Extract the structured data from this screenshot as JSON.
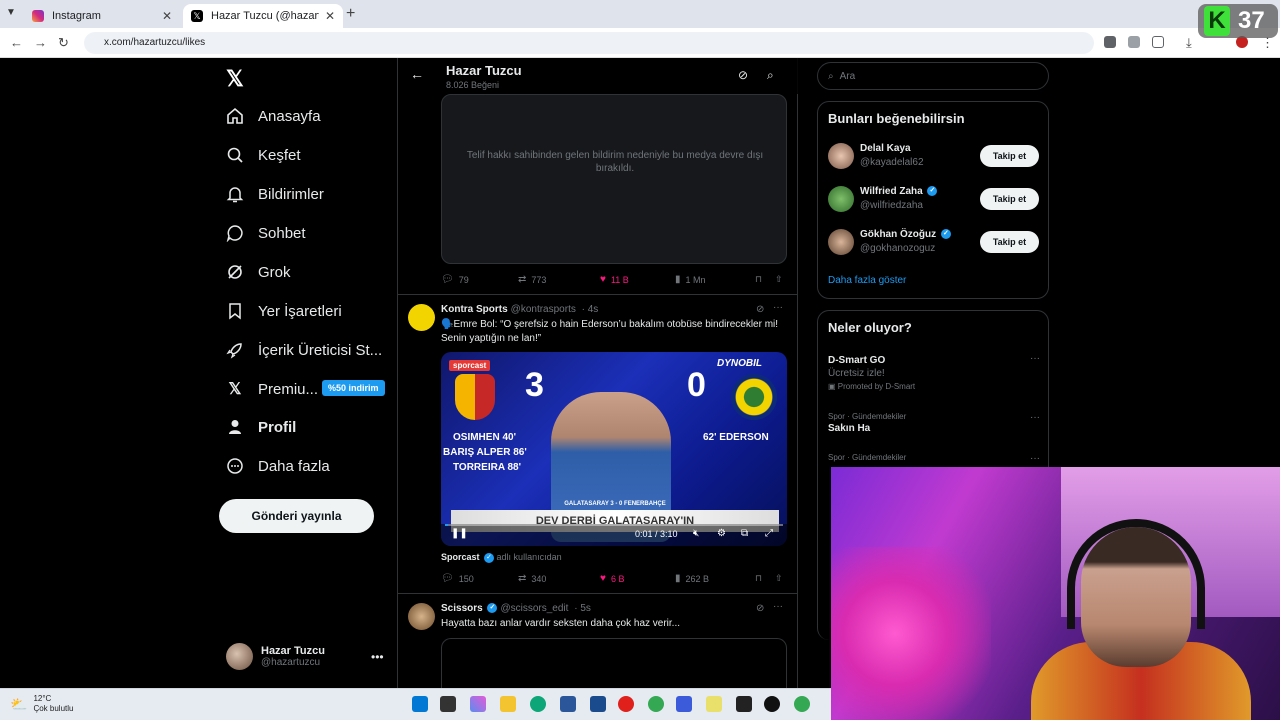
{
  "browser": {
    "tabs": [
      {
        "title": "Instagram",
        "active": false
      },
      {
        "title": "Hazar Tuzcu (@hazartuzcu) adlı",
        "active": true
      }
    ],
    "url": "x.com/hazartuzcu/likes"
  },
  "overlay": {
    "counter": "37",
    "counter_logo": "K"
  },
  "sidebar": {
    "items": [
      {
        "label": "Anasayfa",
        "icon": "home-icon"
      },
      {
        "label": "Keşfet",
        "icon": "search-icon"
      },
      {
        "label": "Bildirimler",
        "icon": "bell-icon"
      },
      {
        "label": "Sohbet",
        "icon": "chat-icon"
      },
      {
        "label": "Grok",
        "icon": "grok-icon"
      },
      {
        "label": "Yer İşaretleri",
        "icon": "bookmark-icon"
      },
      {
        "label": "İçerik Üreticisi St...",
        "icon": "rocket-icon"
      },
      {
        "label": "Premiu...",
        "icon": "x-icon"
      },
      {
        "label": "Profil",
        "icon": "person-icon"
      },
      {
        "label": "Daha fazla",
        "icon": "more-circle-icon"
      }
    ],
    "premium_badge": "%50 indirim",
    "post_button": "Gönderi yayınla",
    "user": {
      "name": "Hazar Tuzcu",
      "handle": "@hazartuzcu"
    }
  },
  "header": {
    "title": "Hazar Tuzcu",
    "subtitle": "8.026 Beğeni"
  },
  "posts": [
    {
      "media_notice": "Telif hakkı sahibinden gelen bildirim nedeniyle bu medya devre dışı bırakıldı.",
      "replies": "79",
      "reposts": "773",
      "likes": "11 B",
      "views": "1 Mn"
    },
    {
      "author": "Kontra Sports",
      "handle": "@kontrasports",
      "time": "· 4s",
      "text": "🗣️Emre Bol: “O şerefsiz o hain Ederson’u bakalım otobüse bindirecekler mi! Senin yaptığın ne lan!”",
      "video": {
        "score_home": "3",
        "score_away": "0",
        "scorers_left": [
          "OSIMHEN  40'",
          "BARIŞ ALPER  86'",
          "TORREIRA  88'"
        ],
        "scorer_right": "62'  EDERSON",
        "banner": "DEV DERBİ GALATASARAY'IN",
        "banner_small": "GALATASARAY 3 - 0 FENERBAHÇE",
        "brand": "DYNOBIL",
        "channel": "sporcast",
        "time": "0:01 / 3:10"
      },
      "source_name": "Sporcast",
      "source_suffix": "adlı kullanıcıdan",
      "replies": "150",
      "reposts": "340",
      "likes": "6 B",
      "views": "262 B"
    },
    {
      "author": "Scissors",
      "handle": "@scissors_edit",
      "time": "· 5s",
      "text": "Hayatta bazı anlar vardır seksten daha çok haz verir..."
    }
  ],
  "right": {
    "search_placeholder": "Ara",
    "suggest_title": "Bunları beğenebilirsin",
    "suggestions": [
      {
        "name": "Delal Kaya",
        "handle": "@kayadelal62",
        "verified": false,
        "button": "Takip et"
      },
      {
        "name": "Wilfried Zaha",
        "handle": "@wilfriedzaha",
        "verified": true,
        "button": "Takip et"
      },
      {
        "name": "Gökhan Özoğuz",
        "handle": "@gokhanozoguz",
        "verified": true,
        "button": "Takip et"
      }
    ],
    "show_more": "Daha fazla göster",
    "trends_title": "Neler oluyor?",
    "trends": [
      {
        "category": "",
        "title": "D-Smart GO",
        "subtitle": "Ücretsiz izle!",
        "promo": "Promoted by D-Smart"
      },
      {
        "category": "Spor · Gündemdekiler",
        "title": "Sakın Ha"
      },
      {
        "category": "Spor · Gündemdekiler",
        "title": ""
      }
    ]
  },
  "taskbar": {
    "temp": "12°C",
    "weather": "Çok bulutlu"
  },
  "colors": {
    "accent": "#1d9bf0",
    "like": "#f91880",
    "background": "#000000"
  }
}
